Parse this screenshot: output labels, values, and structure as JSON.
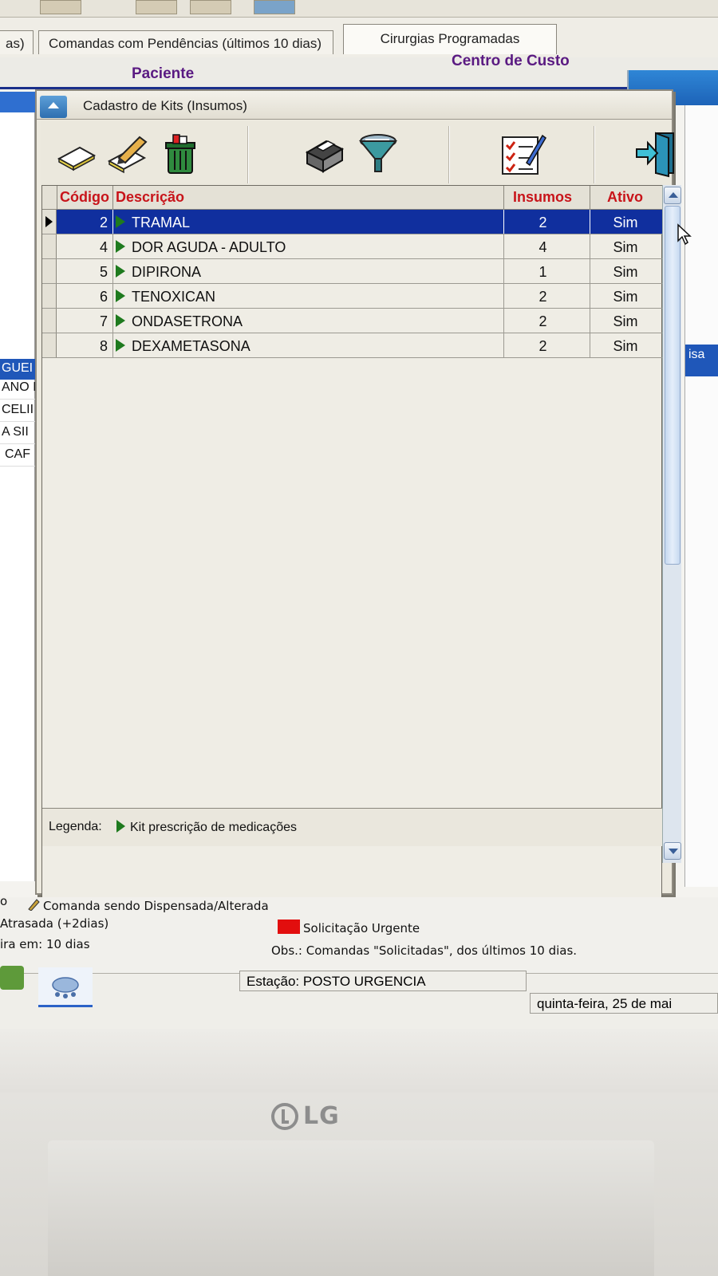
{
  "tabs": [
    {
      "label": "as)"
    },
    {
      "label": "Comandas com Pendências (últimos 10 dias)"
    },
    {
      "label": "Cirurgias Programadas"
    }
  ],
  "header": {
    "paciente": "Paciente",
    "centro_custo": "Centro de Custo"
  },
  "background_list": {
    "selected": "GUEI",
    "rows": [
      "ANO I",
      "CELII",
      "A SII",
      "CAF"
    ]
  },
  "background_right": {
    "text": "isa"
  },
  "dialog": {
    "title": "Cadastro de Kits (Insumos)",
    "toolbar": {
      "icons": [
        "new-icon",
        "edit-icon",
        "delete-icon",
        "print-icon",
        "filter-icon",
        "checklist-icon",
        "exit-icon"
      ]
    },
    "grid": {
      "columns": {
        "codigo": "Código",
        "descricao": "Descrição",
        "insumos": "Insumos",
        "ativo": "Ativo"
      },
      "rows": [
        {
          "codigo": "2",
          "descricao": "TRAMAL",
          "insumos": "2",
          "ativo": "Sim"
        },
        {
          "codigo": "4",
          "descricao": "DOR AGUDA - ADULTO",
          "insumos": "4",
          "ativo": "Sim"
        },
        {
          "codigo": "5",
          "descricao": "DIPIRONA",
          "insumos": "1",
          "ativo": "Sim"
        },
        {
          "codigo": "6",
          "descricao": "TENOXICAN",
          "insumos": "2",
          "ativo": "Sim"
        },
        {
          "codigo": "7",
          "descricao": "ONDASETRONA",
          "insumos": "2",
          "ativo": "Sim"
        },
        {
          "codigo": "8",
          "descricao": "DEXAMETASONA",
          "insumos": "2",
          "ativo": "Sim"
        }
      ]
    },
    "legend": {
      "label": "Legenda:",
      "text": "Kit prescrição de medicações"
    }
  },
  "bottom": {
    "line1_left": "o",
    "dispensada": "Comanda sendo Dispensada/Alterada",
    "atrasada": "Atrasada (+2dias)",
    "urgente": "Solicitação Urgente",
    "obs": "Obs.: Comandas \"Solicitadas\", dos últimos 10 dias.",
    "ira_em": "ira em: 10 dias",
    "estacao": "Estação: POSTO URGENCIA",
    "data": "quinta-feira,  25 de mai"
  },
  "monitor": {
    "brand": "LG"
  },
  "colors": {
    "selection": "#102f9e",
    "header_text": "#c8141a",
    "arrow": "#1e7a1e",
    "urgent": "#e20e0e"
  }
}
